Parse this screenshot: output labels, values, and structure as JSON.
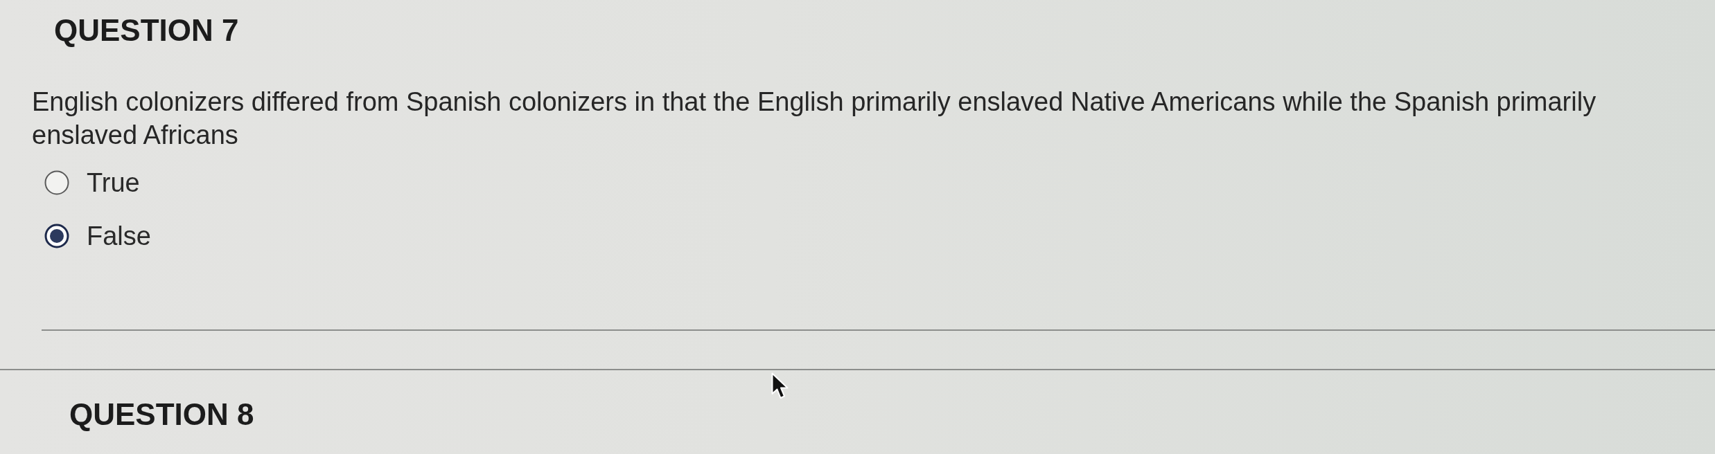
{
  "questions": [
    {
      "heading": "QUESTION 7",
      "prompt": "English colonizers differed from Spanish colonizers in that the English primarily enslaved Native Americans while the Spanish primarily enslaved Africans",
      "options": [
        {
          "label": "True",
          "selected": false
        },
        {
          "label": "False",
          "selected": true
        }
      ]
    },
    {
      "heading": "QUESTION 8"
    }
  ]
}
